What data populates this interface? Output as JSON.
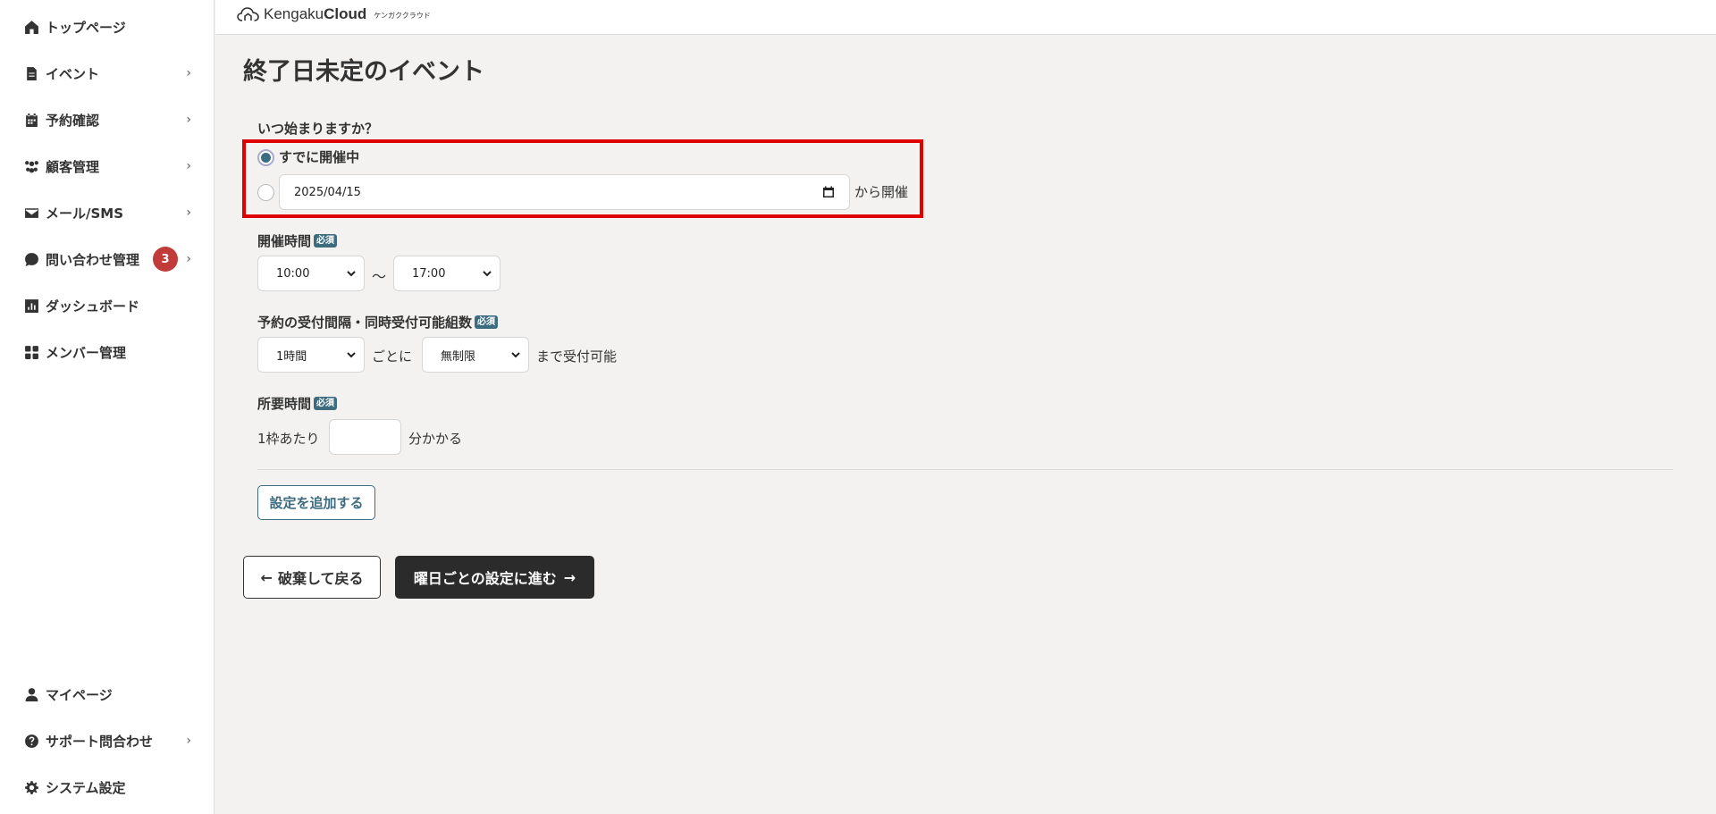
{
  "header": {
    "logo_word_regular": "Kengaku",
    "logo_word_bold": "Cloud",
    "logo_kana": "ケンガククラウド"
  },
  "sidebar": {
    "items": [
      {
        "label": "トップページ",
        "icon": "home-icon",
        "chevron": false
      },
      {
        "label": "イベント",
        "icon": "document-icon",
        "chevron": true
      },
      {
        "label": "予約確認",
        "icon": "calendar-icon",
        "chevron": true
      },
      {
        "label": "顧客管理",
        "icon": "users-icon",
        "chevron": true
      },
      {
        "label": "メール/SMS",
        "icon": "mail-icon",
        "chevron": true
      },
      {
        "label": "問い合わせ管理",
        "icon": "chat-bubble-icon",
        "chevron": true,
        "badge": "3"
      },
      {
        "label": "ダッシュボード",
        "icon": "chart-icon",
        "chevron": false
      },
      {
        "label": "メンバー管理",
        "icon": "grid-icon",
        "chevron": false
      }
    ],
    "bottom_items": [
      {
        "label": "マイページ",
        "icon": "person-icon",
        "chevron": false
      },
      {
        "label": "サポート問合わせ",
        "icon": "question-icon",
        "chevron": true
      },
      {
        "label": "システム設定",
        "icon": "gear-icon",
        "chevron": false
      }
    ],
    "chevron_glyph": "›"
  },
  "main": {
    "title": "終了日未定のイベント",
    "start_question": "いつ始まりますか？",
    "option_already": "すでに開催中",
    "start_date_value": "2025/04/15",
    "start_date_suffix": "から開催",
    "hours_label": "開催時間",
    "required_badge": "必須",
    "hours_start": "10:00",
    "hours_tilde": "〜",
    "hours_end": "17:00",
    "interval_label": "予約の受付間隔・同時受付可能組数",
    "interval_value": "1時間",
    "interval_per": "ごとに",
    "capacity_value": "無制限",
    "capacity_suffix": "まで受付可能",
    "duration_label": "所要時間",
    "duration_prefix": "1枠あたり",
    "duration_value": "",
    "duration_suffix": "分かかる",
    "add_setting_button": "設定を追加する",
    "back_button": "破棄して戻る",
    "next_button": "曜日ごとの設定に進む",
    "back_arrow": "←",
    "next_arrow": "→"
  },
  "colors": {
    "accent": "#3d6b7f",
    "badge_red": "#c23b3b",
    "highlight_red": "#e00000",
    "dark_button": "#2b2b2b",
    "background": "#f3f2f1"
  }
}
